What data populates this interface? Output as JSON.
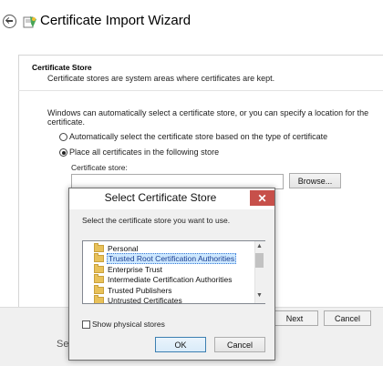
{
  "wizard": {
    "title": "Certificate Import Wizard",
    "section_title": "Certificate Store",
    "section_desc": "Certificate stores are system areas where certificates are kept.",
    "intro": "Windows can automatically select a certificate store, or you can specify a location for the certificate.",
    "radio_auto_label": "Automatically select the certificate store based on the type of certificate",
    "radio_manual_label": "Place all certificates in the following store",
    "radio_selected": "manual",
    "store_label": "Certificate store:",
    "store_value": "",
    "browse_label": "Browse...",
    "next_label": "Next",
    "cancel_label": "Cancel",
    "partial_text": "Se"
  },
  "dialog": {
    "title": "Select Certificate Store",
    "close_symbol": "✕",
    "prompt": "Select the certificate store you want to use.",
    "stores": [
      "Personal",
      "Trusted Root Certification Authorities",
      "Enterprise Trust",
      "Intermediate Certification Authorities",
      "Trusted Publishers",
      "Untrusted Certificates"
    ],
    "selected_store": "Trusted Root Certification Authorities",
    "show_physical_label": "Show physical stores",
    "show_physical_checked": false,
    "ok_label": "OK",
    "cancel_label": "Cancel"
  },
  "icons": {
    "back": "back-arrow-icon",
    "wizard": "certificate-wizard-icon",
    "folder": "folder-icon",
    "close": "close-icon"
  },
  "colors": {
    "close_button": "#c7504a",
    "selection_bg": "#cde8ff",
    "folder": "#e8c15a",
    "ok_border": "#3c7fb1"
  }
}
